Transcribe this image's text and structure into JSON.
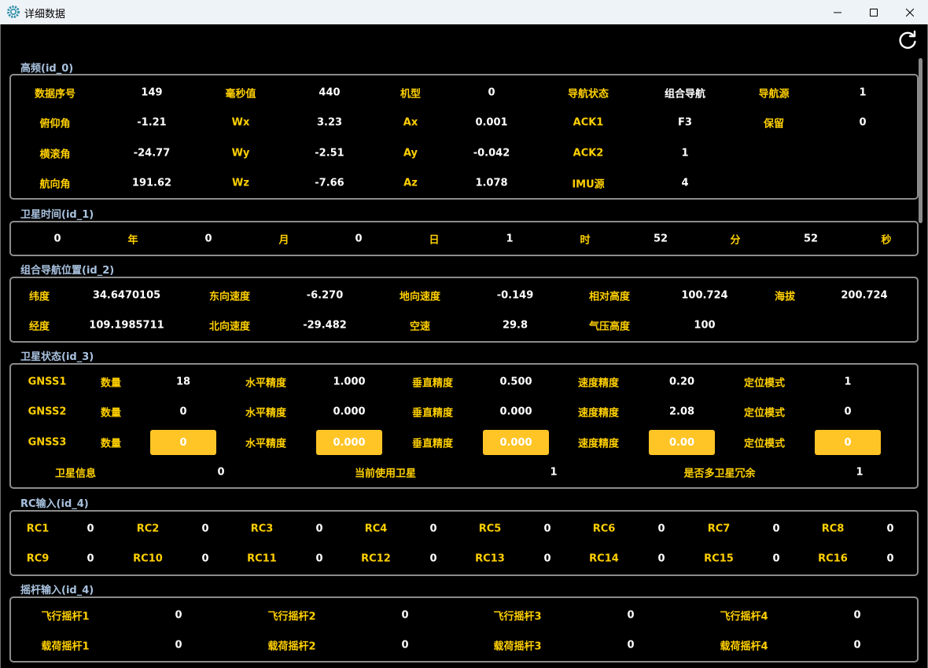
{
  "window": {
    "title": "详细数据"
  },
  "sections": {
    "high_freq": {
      "title": "高频(id_0)",
      "rows": [
        [
          [
            "数据序号",
            "149"
          ],
          [
            "毫秒值",
            "440"
          ],
          [
            "机型",
            "0"
          ],
          [
            "导航状态",
            "组合导航"
          ],
          [
            "导航源",
            "1"
          ]
        ],
        [
          [
            "俯仰角",
            "-1.21"
          ],
          [
            "Wx",
            "3.23"
          ],
          [
            "Ax",
            "0.001"
          ],
          [
            "ACK1",
            "F3"
          ],
          [
            "保留",
            "0"
          ]
        ],
        [
          [
            "横滚角",
            "-24.77"
          ],
          [
            "Wy",
            "-2.51"
          ],
          [
            "Ay",
            "-0.042"
          ],
          [
            "ACK2",
            "1"
          ]
        ],
        [
          [
            "航向角",
            "191.62"
          ],
          [
            "Wz",
            "-7.66"
          ],
          [
            "Az",
            "1.078"
          ],
          [
            "IMU源",
            "4"
          ]
        ]
      ]
    },
    "sat_time": {
      "title": "卫星时间(id_1)",
      "row": [
        [
          "0",
          "年"
        ],
        [
          "0",
          "月"
        ],
        [
          "0",
          "日"
        ],
        [
          "1",
          "时"
        ],
        [
          "52",
          "分"
        ],
        [
          "52",
          "秒"
        ]
      ]
    },
    "nav_pos": {
      "title": "组合导航位置(id_2)",
      "rows": [
        [
          [
            "纬度",
            "34.6470105"
          ],
          [
            "东向速度",
            "-6.270"
          ],
          [
            "地向速度",
            "-0.149"
          ],
          [
            "相对高度",
            "100.724"
          ],
          [
            "海拔",
            "200.724"
          ]
        ],
        [
          [
            "经度",
            "109.1985711"
          ],
          [
            "北向速度",
            "-29.482"
          ],
          [
            "空速",
            "29.8"
          ],
          [
            "气压高度",
            "100"
          ]
        ]
      ]
    },
    "sat_status": {
      "title": "卫星状态(id_3)",
      "gnss": [
        {
          "name": "GNSS1",
          "vals": [
            [
              "数量",
              "18"
            ],
            [
              "水平精度",
              "1.000"
            ],
            [
              "垂直精度",
              "0.500"
            ],
            [
              "速度精度",
              "0.20"
            ],
            [
              "定位模式",
              "1"
            ]
          ]
        },
        {
          "name": "GNSS2",
          "vals": [
            [
              "数量",
              "0"
            ],
            [
              "水平精度",
              "0.000"
            ],
            [
              "垂直精度",
              "0.000"
            ],
            [
              "速度精度",
              "2.08"
            ],
            [
              "定位模式",
              "0"
            ]
          ]
        },
        {
          "name": "GNSS3",
          "vals": [
            [
              "数量",
              "0"
            ],
            [
              "水平精度",
              "0.000"
            ],
            [
              "垂直精度",
              "0.000"
            ],
            [
              "速度精度",
              "0.00"
            ],
            [
              "定位模式",
              "0"
            ]
          ]
        }
      ],
      "info": [
        [
          "卫星信息",
          "0"
        ],
        [
          "当前使用卫星",
          "1"
        ],
        [
          "是否多卫星冗余",
          "1"
        ]
      ]
    },
    "rc": {
      "title": "RC输入(id_4)",
      "rows": [
        [
          [
            "RC1",
            "0"
          ],
          [
            "RC2",
            "0"
          ],
          [
            "RC3",
            "0"
          ],
          [
            "RC4",
            "0"
          ],
          [
            "RC5",
            "0"
          ],
          [
            "RC6",
            "0"
          ],
          [
            "RC7",
            "0"
          ],
          [
            "RC8",
            "0"
          ]
        ],
        [
          [
            "RC9",
            "0"
          ],
          [
            "RC10",
            "0"
          ],
          [
            "RC11",
            "0"
          ],
          [
            "RC12",
            "0"
          ],
          [
            "RC13",
            "0"
          ],
          [
            "RC14",
            "0"
          ],
          [
            "RC15",
            "0"
          ],
          [
            "RC16",
            "0"
          ]
        ]
      ]
    },
    "stick": {
      "title": "摇杆输入(id_4)",
      "rows": [
        [
          [
            "飞行摇杆1",
            "0"
          ],
          [
            "飞行摇杆2",
            "0"
          ],
          [
            "飞行摇杆3",
            "0"
          ],
          [
            "飞行摇杆4",
            "0"
          ]
        ],
        [
          [
            "载荷摇杆1",
            "0"
          ],
          [
            "载荷摇杆2",
            "0"
          ],
          [
            "载荷摇杆3",
            "0"
          ],
          [
            "载荷摇杆4",
            "0"
          ]
        ]
      ]
    }
  }
}
